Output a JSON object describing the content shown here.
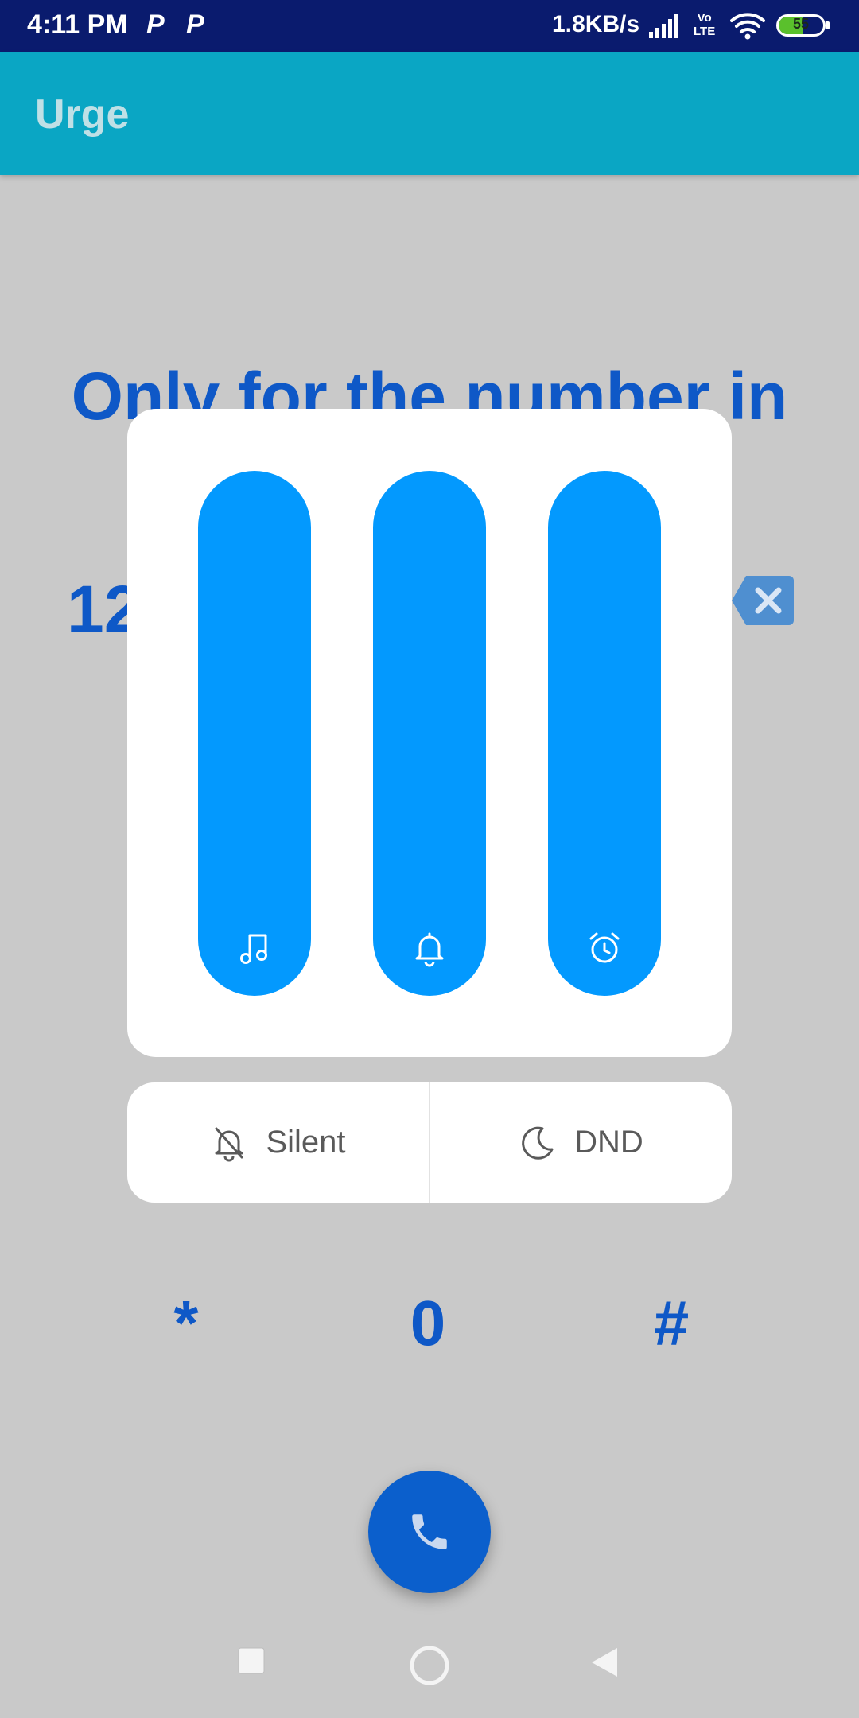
{
  "status_bar": {
    "time": "4:11 PM",
    "notif_icons": [
      "P",
      "P"
    ],
    "net_speed": "1.8KB/s",
    "volte_top": "Vo",
    "volte_bottom": "LTE",
    "battery_level": "55",
    "battery_fraction": 0.55
  },
  "app_bar": {
    "title": "Urge"
  },
  "background": {
    "headline": "Only for the number in",
    "number_preview": "12",
    "keys": [
      "*",
      "0",
      "#"
    ]
  },
  "volume_dialog": {
    "sliders": [
      {
        "name": "media",
        "icon": "music-note-icon",
        "level": 1.0
      },
      {
        "name": "ringer",
        "icon": "bell-icon",
        "level": 1.0
      },
      {
        "name": "alarm",
        "icon": "alarm-clock-icon",
        "level": 1.0
      }
    ],
    "modes": {
      "silent_label": "Silent",
      "dnd_label": "DND"
    }
  },
  "colors": {
    "status_bar": "#0a1b6e",
    "app_bar": "#0aa6c4",
    "accent_text": "#0e58c7",
    "slider_fill": "#0399fe",
    "scrim": "#c9c9c9",
    "fab": "#0b5fcc"
  }
}
